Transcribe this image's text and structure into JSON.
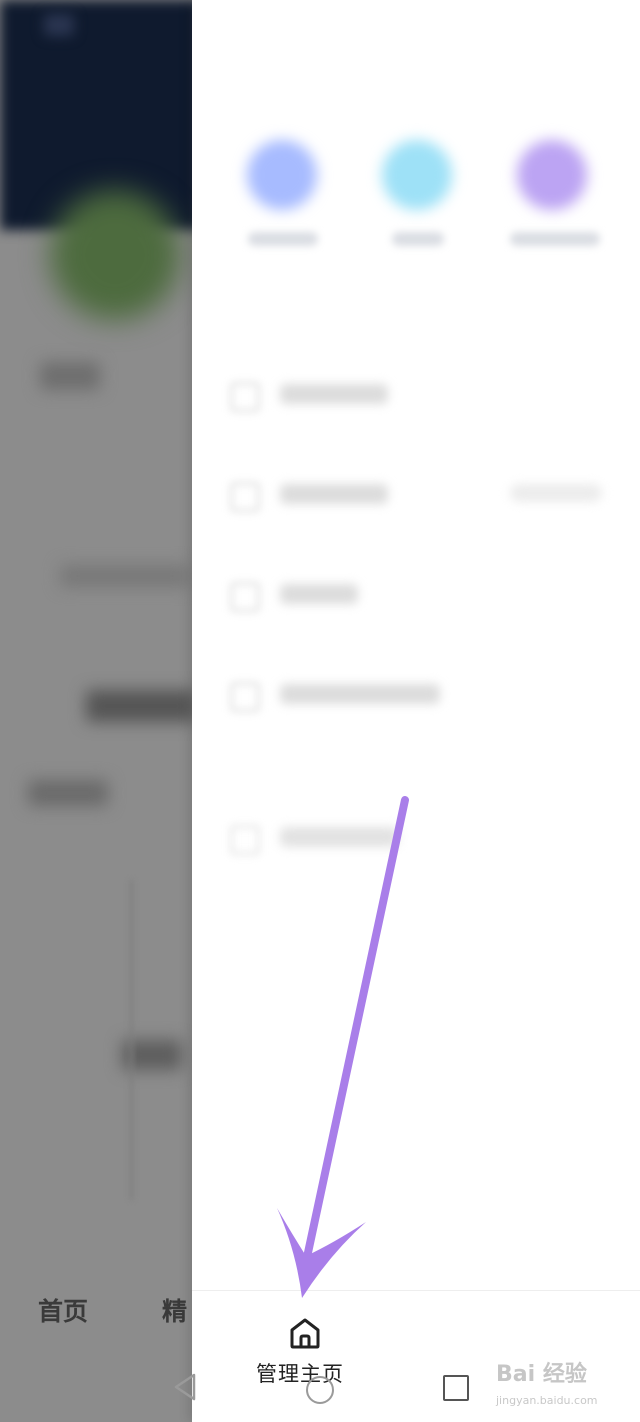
{
  "left_app": {
    "tabs": [
      "首页",
      "精"
    ]
  },
  "drawer": {
    "bottom": {
      "home_label": "管理主页",
      "home_icon": "home-icon"
    },
    "quick_actions": [
      {
        "color": "#a7bbff"
      },
      {
        "color": "#9ee1f7"
      },
      {
        "color": "#bca4f3"
      }
    ]
  },
  "annotation": {
    "arrow_color": "#a97ee9",
    "points_to": "drawer-home-button"
  },
  "watermark": {
    "brand": "Bai 经验",
    "url": "jingyan.baidu.com"
  },
  "system_nav": {
    "icons": [
      "back-icon",
      "home-circle-icon",
      "recents-icon"
    ]
  }
}
